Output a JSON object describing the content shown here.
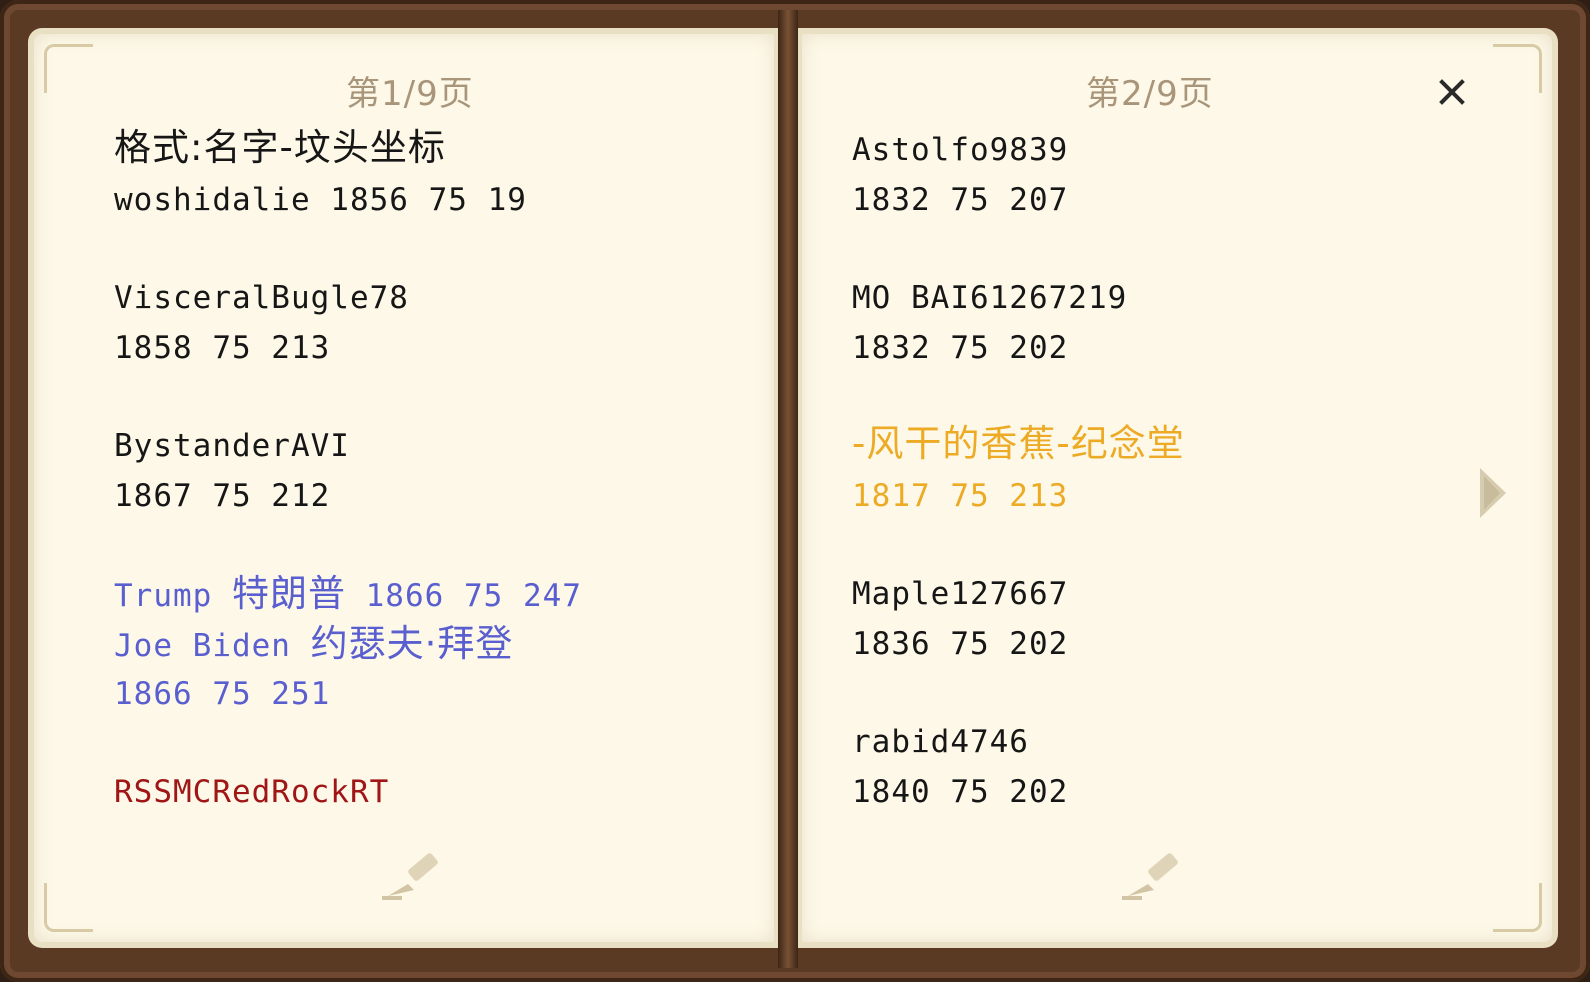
{
  "left_page": {
    "page_number": "第1/9页",
    "lines": {
      "l0": "格式:名字-坟头坐标",
      "l1": "woshidalie 1856 75 19",
      "l2": "VisceralBugle78",
      "l3": "1858 75 213",
      "l4": "BystanderAVI",
      "l5": "1867 75 212",
      "l6a": "Trump ",
      "l6b": "特朗普",
      "l6c": " 1866 75 247",
      "l7a": "Joe Biden ",
      "l7b": "约瑟夫·拜登",
      "l8": "1866 75 251",
      "l9": "RSSMCRedRockRT"
    }
  },
  "right_page": {
    "page_number": "第2/9页",
    "lines": {
      "r0": "Astolfo9839",
      "r1": "1832 75 207",
      "r2": "MO BAI61267219",
      "r3": "1832 75 202",
      "r4": "-风干的香蕉-纪念堂",
      "r5": "1817 75 213",
      "r6": "Maple127667",
      "r7": "1836 75 202",
      "r8": "rabid4746",
      "r9": "1840 75 202"
    }
  },
  "controls": {
    "close_icon": "close-icon",
    "next_icon": "next-page-arrow-icon",
    "edit_icon": "quill-edit-icon"
  },
  "colors": {
    "text_default": "#161616",
    "text_blue": "#5a5fd0",
    "text_gold": "#ecaa25",
    "text_red": "#a01515",
    "page_number": "#a8957a",
    "page_bg": "#fdf8e8",
    "cover": "#5b3a24"
  }
}
